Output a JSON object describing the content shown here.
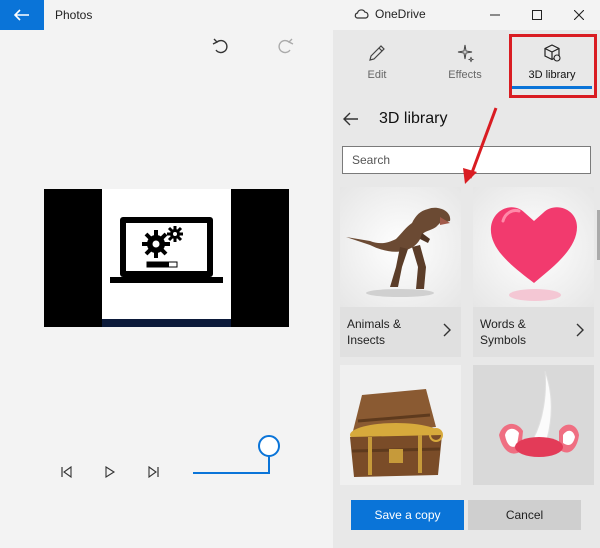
{
  "titlebar": {
    "app_title": "Photos",
    "cloud_label": "OneDrive"
  },
  "tabs": [
    {
      "label": "Edit",
      "icon": "pencil-icon"
    },
    {
      "label": "Effects",
      "icon": "sparkle-icon"
    },
    {
      "label": "3D library",
      "icon": "cube-icon"
    }
  ],
  "library": {
    "title": "3D library",
    "search_placeholder": "Search"
  },
  "cards": [
    {
      "label": "Animals &\nInsects"
    },
    {
      "label": "Words &\nSymbols"
    }
  ],
  "buttons": {
    "save": "Save a copy",
    "cancel": "Cancel"
  },
  "colors": {
    "accent": "#0a74d8",
    "highlight": "#d91c22"
  }
}
